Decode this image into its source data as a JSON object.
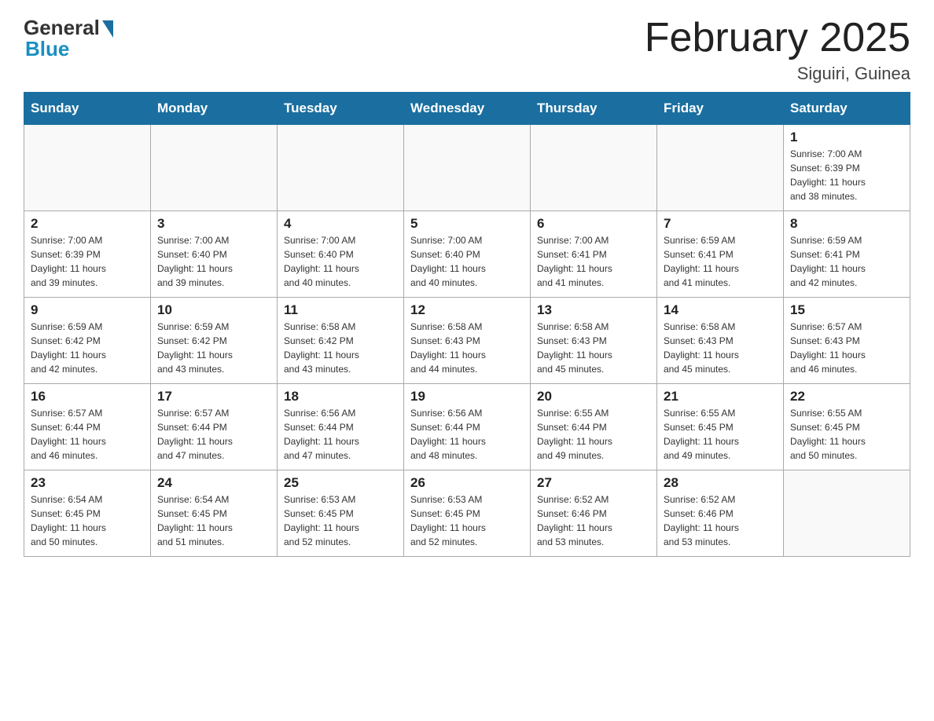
{
  "header": {
    "logo_general": "General",
    "logo_blue": "Blue",
    "month_title": "February 2025",
    "subtitle": "Siguiri, Guinea"
  },
  "weekdays": [
    "Sunday",
    "Monday",
    "Tuesday",
    "Wednesday",
    "Thursday",
    "Friday",
    "Saturday"
  ],
  "weeks": [
    [
      {
        "day": "",
        "info": ""
      },
      {
        "day": "",
        "info": ""
      },
      {
        "day": "",
        "info": ""
      },
      {
        "day": "",
        "info": ""
      },
      {
        "day": "",
        "info": ""
      },
      {
        "day": "",
        "info": ""
      },
      {
        "day": "1",
        "info": "Sunrise: 7:00 AM\nSunset: 6:39 PM\nDaylight: 11 hours\nand 38 minutes."
      }
    ],
    [
      {
        "day": "2",
        "info": "Sunrise: 7:00 AM\nSunset: 6:39 PM\nDaylight: 11 hours\nand 39 minutes."
      },
      {
        "day": "3",
        "info": "Sunrise: 7:00 AM\nSunset: 6:40 PM\nDaylight: 11 hours\nand 39 minutes."
      },
      {
        "day": "4",
        "info": "Sunrise: 7:00 AM\nSunset: 6:40 PM\nDaylight: 11 hours\nand 40 minutes."
      },
      {
        "day": "5",
        "info": "Sunrise: 7:00 AM\nSunset: 6:40 PM\nDaylight: 11 hours\nand 40 minutes."
      },
      {
        "day": "6",
        "info": "Sunrise: 7:00 AM\nSunset: 6:41 PM\nDaylight: 11 hours\nand 41 minutes."
      },
      {
        "day": "7",
        "info": "Sunrise: 6:59 AM\nSunset: 6:41 PM\nDaylight: 11 hours\nand 41 minutes."
      },
      {
        "day": "8",
        "info": "Sunrise: 6:59 AM\nSunset: 6:41 PM\nDaylight: 11 hours\nand 42 minutes."
      }
    ],
    [
      {
        "day": "9",
        "info": "Sunrise: 6:59 AM\nSunset: 6:42 PM\nDaylight: 11 hours\nand 42 minutes."
      },
      {
        "day": "10",
        "info": "Sunrise: 6:59 AM\nSunset: 6:42 PM\nDaylight: 11 hours\nand 43 minutes."
      },
      {
        "day": "11",
        "info": "Sunrise: 6:58 AM\nSunset: 6:42 PM\nDaylight: 11 hours\nand 43 minutes."
      },
      {
        "day": "12",
        "info": "Sunrise: 6:58 AM\nSunset: 6:43 PM\nDaylight: 11 hours\nand 44 minutes."
      },
      {
        "day": "13",
        "info": "Sunrise: 6:58 AM\nSunset: 6:43 PM\nDaylight: 11 hours\nand 45 minutes."
      },
      {
        "day": "14",
        "info": "Sunrise: 6:58 AM\nSunset: 6:43 PM\nDaylight: 11 hours\nand 45 minutes."
      },
      {
        "day": "15",
        "info": "Sunrise: 6:57 AM\nSunset: 6:43 PM\nDaylight: 11 hours\nand 46 minutes."
      }
    ],
    [
      {
        "day": "16",
        "info": "Sunrise: 6:57 AM\nSunset: 6:44 PM\nDaylight: 11 hours\nand 46 minutes."
      },
      {
        "day": "17",
        "info": "Sunrise: 6:57 AM\nSunset: 6:44 PM\nDaylight: 11 hours\nand 47 minutes."
      },
      {
        "day": "18",
        "info": "Sunrise: 6:56 AM\nSunset: 6:44 PM\nDaylight: 11 hours\nand 47 minutes."
      },
      {
        "day": "19",
        "info": "Sunrise: 6:56 AM\nSunset: 6:44 PM\nDaylight: 11 hours\nand 48 minutes."
      },
      {
        "day": "20",
        "info": "Sunrise: 6:55 AM\nSunset: 6:44 PM\nDaylight: 11 hours\nand 49 minutes."
      },
      {
        "day": "21",
        "info": "Sunrise: 6:55 AM\nSunset: 6:45 PM\nDaylight: 11 hours\nand 49 minutes."
      },
      {
        "day": "22",
        "info": "Sunrise: 6:55 AM\nSunset: 6:45 PM\nDaylight: 11 hours\nand 50 minutes."
      }
    ],
    [
      {
        "day": "23",
        "info": "Sunrise: 6:54 AM\nSunset: 6:45 PM\nDaylight: 11 hours\nand 50 minutes."
      },
      {
        "day": "24",
        "info": "Sunrise: 6:54 AM\nSunset: 6:45 PM\nDaylight: 11 hours\nand 51 minutes."
      },
      {
        "day": "25",
        "info": "Sunrise: 6:53 AM\nSunset: 6:45 PM\nDaylight: 11 hours\nand 52 minutes."
      },
      {
        "day": "26",
        "info": "Sunrise: 6:53 AM\nSunset: 6:45 PM\nDaylight: 11 hours\nand 52 minutes."
      },
      {
        "day": "27",
        "info": "Sunrise: 6:52 AM\nSunset: 6:46 PM\nDaylight: 11 hours\nand 53 minutes."
      },
      {
        "day": "28",
        "info": "Sunrise: 6:52 AM\nSunset: 6:46 PM\nDaylight: 11 hours\nand 53 minutes."
      },
      {
        "day": "",
        "info": ""
      }
    ]
  ]
}
